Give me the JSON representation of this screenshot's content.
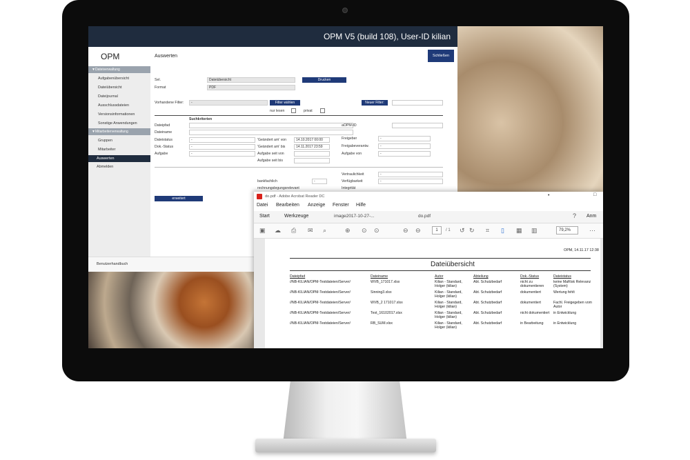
{
  "opm": {
    "title": "OPM V5 (build 108), User-ID kilian",
    "logo": "OPM",
    "sidebar": {
      "sections": [
        {
          "label": "▼Dateiverwaltung",
          "items": [
            "Aufgabenübersicht",
            "Dateiübersicht",
            "Dateijournal",
            "Ausschlussdateien",
            "Versionsinformationen",
            "Sonstige Anwendungen"
          ]
        },
        {
          "label": "▼Mitarbeiterverwaltung",
          "items": [
            "Gruppen",
            "Mitarbeiter"
          ]
        }
      ],
      "active": "Auswerten",
      "logout": "Abmelden",
      "help": "Benutzerhandbuch"
    },
    "main": {
      "title": "Auswerten",
      "close": "Schließen",
      "sel_label": "Sel.",
      "sel_value": "Dateiübersicht",
      "print": "Drucken",
      "format_label": "Format",
      "format_value": "PDF",
      "filter_label": "Vorhandene Filter:",
      "filter_value": "-",
      "filter_btn": "Filter wählen",
      "new_filter": "Neuer Filter:",
      "readonly": "nur lesen",
      "private": "privat",
      "search_title": "Suchkriterien",
      "dateipfad": "Dateipfad",
      "dateiname": "Dateiname",
      "opm_id": "aOPM-ID",
      "dateistatus": "Dateistatus",
      "dokstatus": "Dok.-Status",
      "aufgabe": "Aufgabe",
      "dash": "-",
      "changed_from": "'Geändert am' von",
      "changed_from_val": "14.10.2017 00:00",
      "changed_to": "'Geändert am' bis",
      "changed_to_val": "14.11.2017 23:59",
      "task_from": "Aufgabe seit von",
      "task_to": "Aufgabe seit bis",
      "freigeber": "Freigeber",
      "freigabe_verantw": "Freigabeverantw.",
      "aufgabe_von": "Aufgabe von",
      "vertraulichkeit": "Vertraulichkeit",
      "verfuegbarkeit": "Verfügbarkeit",
      "integritaet": "Integrität",
      "bankfachlich": "bankfachlich",
      "rechnungslegung": "rechnungslegungsrelevant",
      "extended": "erweitert"
    }
  },
  "acrobat": {
    "title": "do.pdf - Adobe Acrobat Reader DC",
    "menus": [
      "Datei",
      "Bearbeiten",
      "Anzeige",
      "Fenster",
      "Hilfe"
    ],
    "tabs": [
      "Start",
      "Werkzeuge",
      "image2017-10-27-...",
      "do.pdf"
    ],
    "login": "Anm",
    "page_current": "1",
    "page_total": "/ 1",
    "zoom": "79,2%",
    "doc": {
      "date": "OPM, 14.11.17 12:38",
      "title": "Dateiübersicht",
      "headers": [
        "Dateipfad",
        "Dateiname",
        "Autor",
        "Abteilung",
        "Dok.-Status",
        "Dateistatus"
      ],
      "rows": [
        [
          "//NB-KILIAN/OPM-Testdateien/Server/",
          "WVB_171017.xlsx",
          "Kilian - Standard, Holger (kilian)",
          "Abt. Schutzbedarf",
          "nicht zu dokumentieren",
          "keine MaRisk Relevanz (System)"
        ],
        [
          "//NB-KILIAN/OPM-Testdateien/Server/",
          "Sinning3.xlsx",
          "Kilian - Standard, Holger (kilian)",
          "Abt. Schutzbedarf",
          "dokumentiert",
          "Wertung fehlt"
        ],
        [
          "//NB-KILIAN/OPM-Testdateien/Server/",
          "WVB_2 171017.xlsx",
          "Kilian - Standard, Holger (kilian)",
          "Abt. Schutzbedarf",
          "dokumentiert",
          "Fachl. Freigegeben vom Autor"
        ],
        [
          "//NB-KILIAN/OPM-Testdateien/Server/",
          "Test_16102017.xlsx",
          "Kilian - Standard, Holger (kilian)",
          "Abt. Schutzbedarf",
          "nicht dokumentiert",
          "in Entwicklung"
        ],
        [
          "//NB-KILIAN/OPM-Testdateien/Server/",
          "RB_SUM.xlsx",
          "Kilian - Standard, Holger (kilian)",
          "Abt. Schutzbedarf",
          "in Bearbeitung",
          "in Entwicklung"
        ]
      ]
    }
  },
  "colors": {
    "accent": "#1f3a78",
    "header": "#1f2c3e"
  }
}
